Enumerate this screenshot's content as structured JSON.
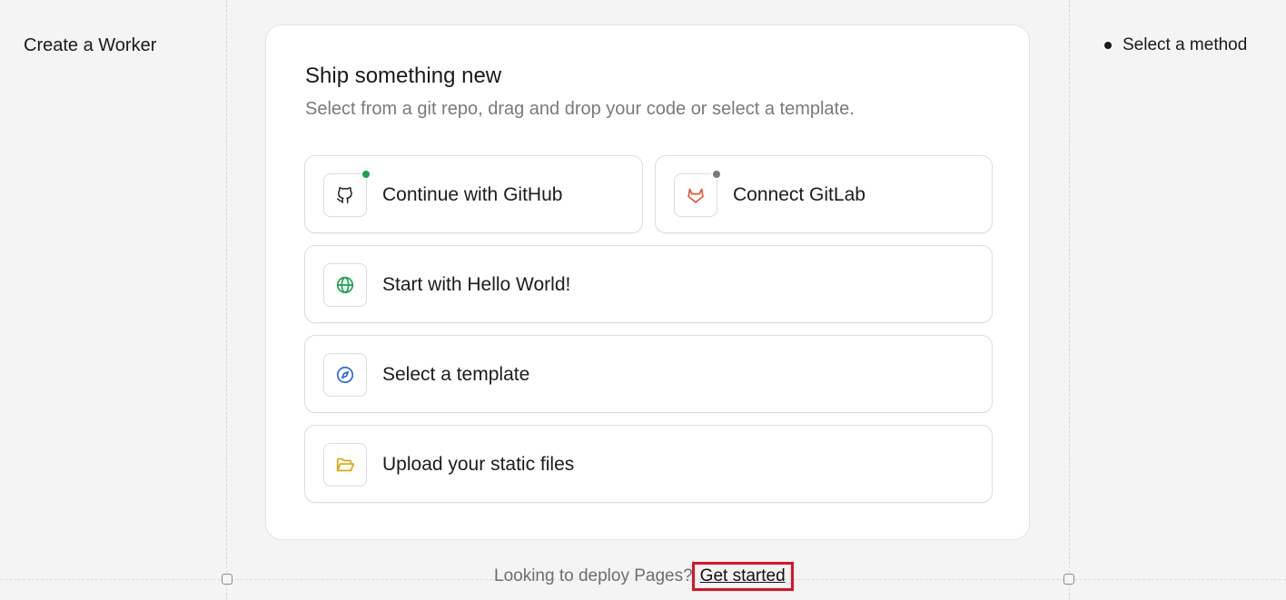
{
  "sidebar": {
    "title": "Create a Worker"
  },
  "steps": {
    "current": "Select a method"
  },
  "card": {
    "title": "Ship something new",
    "subtitle": "Select from a git repo, drag and drop your code or select a template."
  },
  "options": {
    "github": {
      "label": "Continue with GitHub",
      "icon": "github-icon",
      "status_color": "#16a34a"
    },
    "gitlab": {
      "label": "Connect GitLab",
      "icon": "gitlab-icon",
      "status_color": "#7a7a7a"
    },
    "hello_world": {
      "label": "Start with Hello World!",
      "icon": "globe-icon",
      "color": "#16a34a"
    },
    "template": {
      "label": "Select a template",
      "icon": "compass-icon",
      "color": "#2563eb"
    },
    "upload": {
      "label": "Upload your static files",
      "icon": "folder-icon",
      "color": "#e0a400"
    }
  },
  "footer": {
    "prompt": "Looking to deploy Pages?",
    "link": "Get started"
  }
}
